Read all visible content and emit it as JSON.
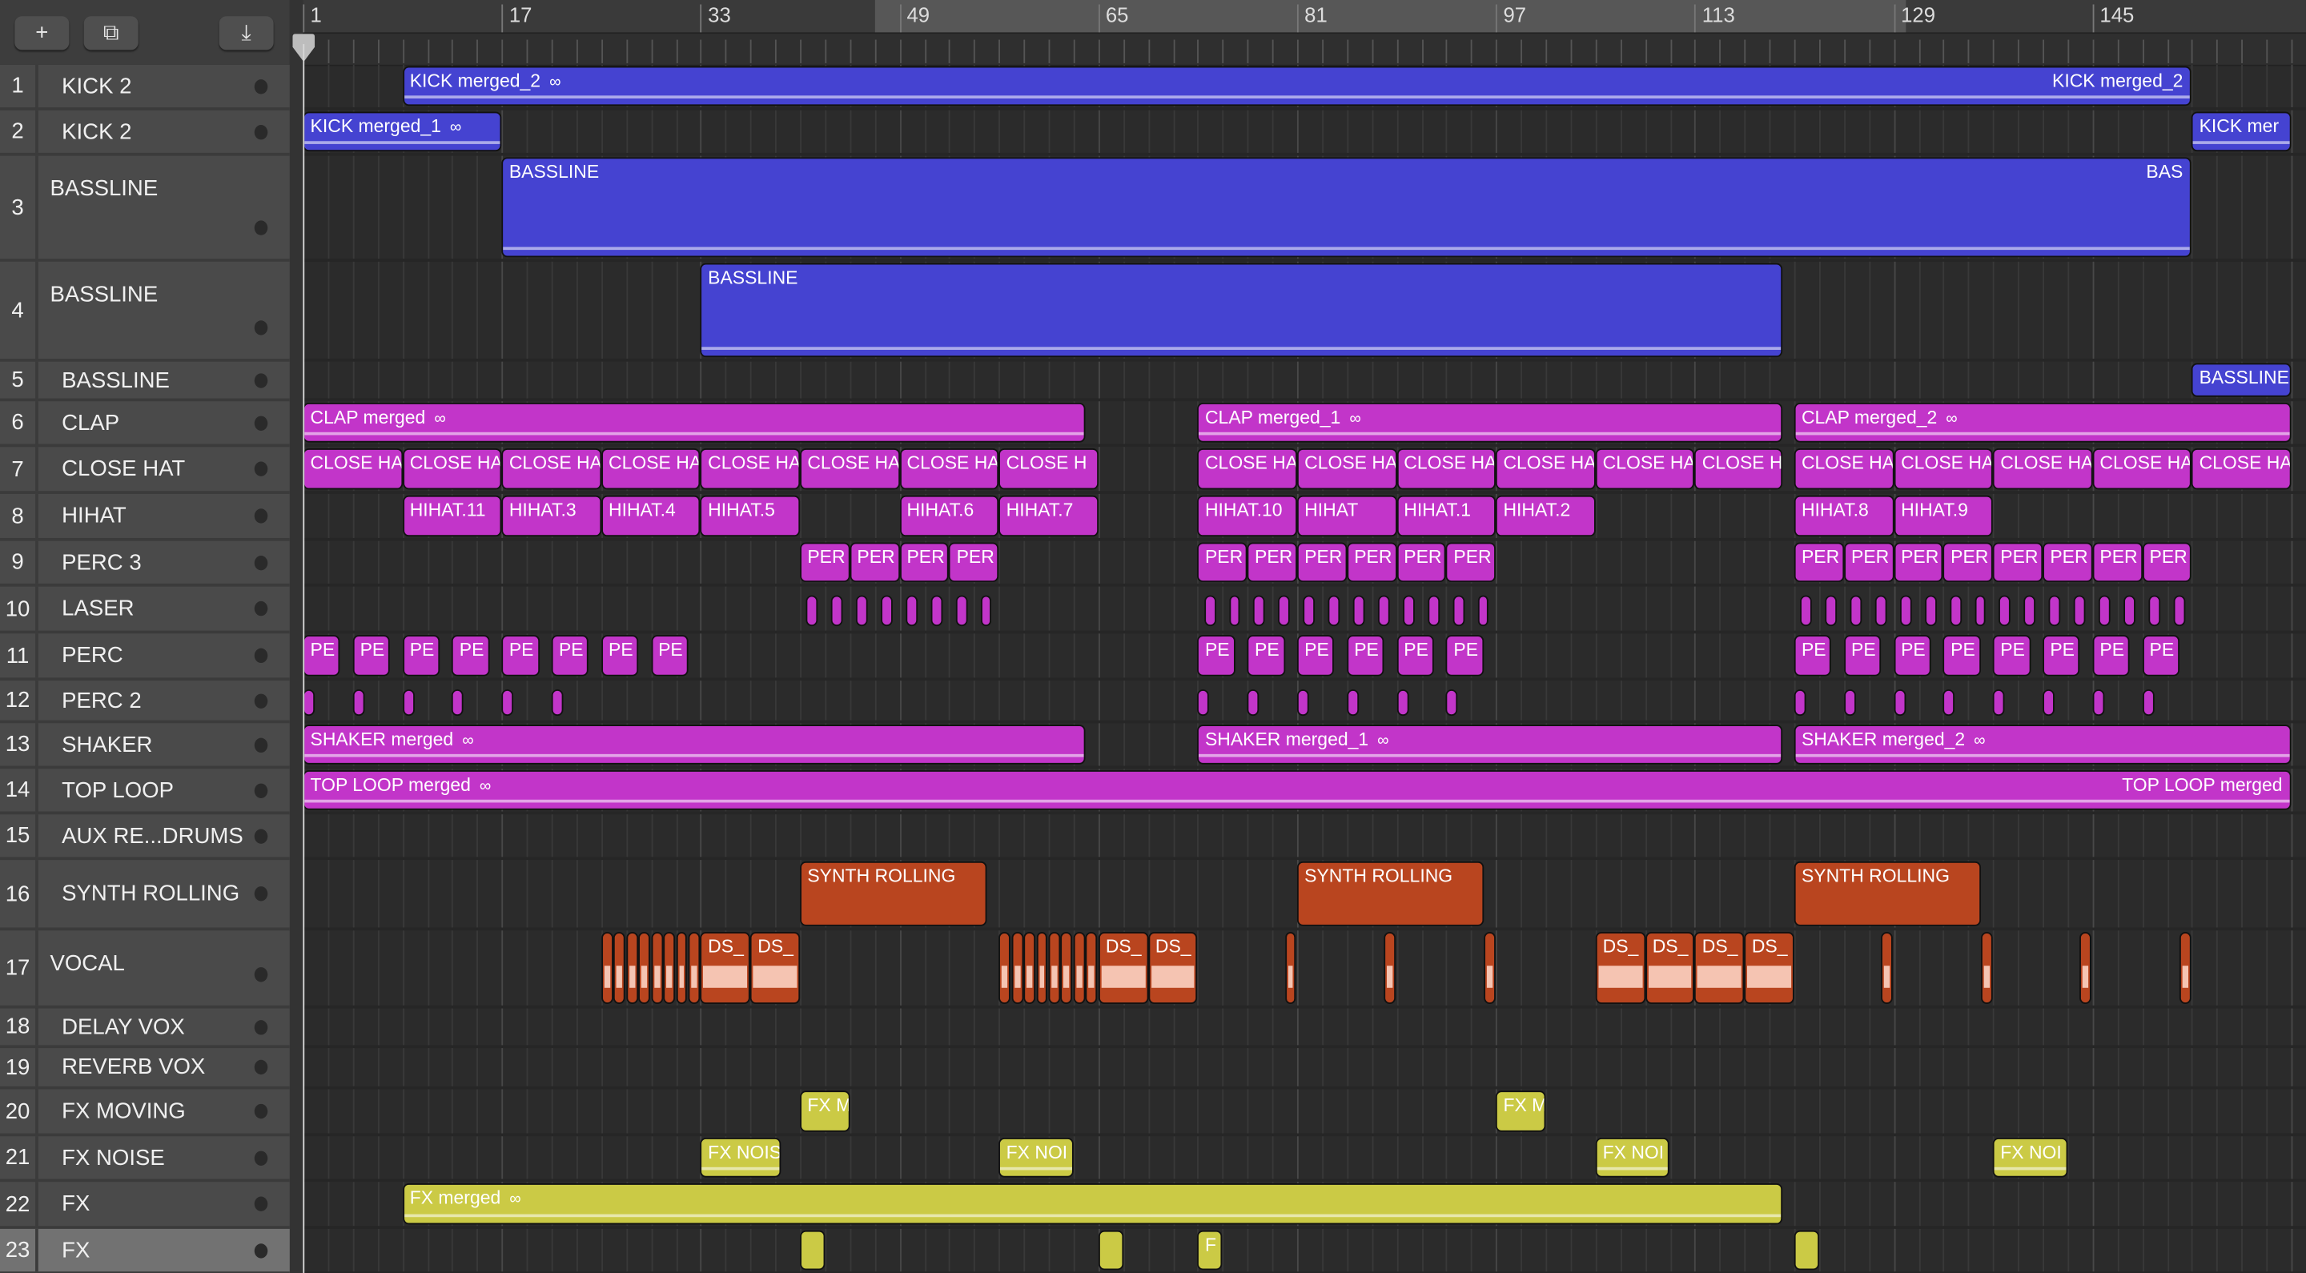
{
  "toolbar": {
    "add_label": "+",
    "duplicate_label": "⧉",
    "download_label": "⤓"
  },
  "ruler": {
    "markers": [
      1,
      17,
      33,
      49,
      65,
      81,
      97,
      113,
      129,
      145
    ],
    "cycle_start_bar": 47,
    "cycle_end_bar": 130
  },
  "colors": {
    "blue": "#4543d1",
    "magenta": "#c235c9",
    "orange": "#b9451f",
    "yellow": "#cbca45"
  },
  "loop_icon": "∞",
  "tracks": [
    {
      "num": "1",
      "name": "KICK 2",
      "color": "blue",
      "regions": [
        [
          "KICK merged_2",
          9,
          153,
          "KICK merged_2",
          "wave",
          true
        ]
      ]
    },
    {
      "num": "2",
      "name": "KICK 2",
      "color": "blue",
      "regions": [
        [
          "KICK merged_1",
          1,
          17,
          "",
          "wave",
          true
        ],
        [
          "KICK mer",
          153,
          161,
          "",
          "wave",
          false
        ]
      ]
    },
    {
      "num": "3",
      "name": "BASSLINE",
      "color": "blue",
      "tall": true,
      "regions": [
        [
          "BASSLINE",
          17,
          153,
          "BAS",
          "wave",
          false
        ]
      ]
    },
    {
      "num": "4",
      "name": "BASSLINE",
      "color": "blue",
      "tall": true,
      "regions": [
        [
          "BASSLINE",
          33,
          120,
          "",
          "wave",
          false
        ]
      ]
    },
    {
      "num": "5",
      "name": "BASSLINE",
      "color": "blue",
      "regions": [
        [
          "BASSLINE",
          153,
          161,
          "",
          "",
          false
        ]
      ]
    },
    {
      "num": "6",
      "name": "CLAP",
      "color": "magenta",
      "regions": [
        [
          "CLAP merged",
          1,
          64,
          "",
          "wave",
          true
        ],
        [
          "CLAP merged_1",
          73,
          120,
          "",
          "wave",
          true
        ],
        [
          "CLAP merged_2",
          121,
          161,
          "",
          "wave",
          true
        ]
      ]
    },
    {
      "num": "7",
      "name": "CLOSE HAT",
      "color": "magenta",
      "regions": [
        [
          "CLOSE HA",
          1,
          9
        ],
        [
          "CLOSE HA",
          9,
          17
        ],
        [
          "CLOSE HA",
          17,
          25
        ],
        [
          "CLOSE HA",
          25,
          33
        ],
        [
          "CLOSE HA",
          33,
          41
        ],
        [
          "CLOSE HA",
          41,
          49
        ],
        [
          "CLOSE HA",
          49,
          57
        ],
        [
          "CLOSE H",
          57,
          65
        ],
        [
          "CLOSE HA",
          73,
          81
        ],
        [
          "CLOSE HA",
          81,
          89
        ],
        [
          "CLOSE HA",
          89,
          97
        ],
        [
          "CLOSE HA",
          97,
          105
        ],
        [
          "CLOSE HA",
          105,
          113
        ],
        [
          "CLOSE H",
          113,
          120
        ],
        [
          "CLOSE HA",
          121,
          129
        ],
        [
          "CLOSE HA",
          129,
          137
        ],
        [
          "CLOSE HA",
          137,
          145
        ],
        [
          "CLOSE HA",
          145,
          153
        ],
        [
          "CLOSE HA",
          153,
          161
        ]
      ]
    },
    {
      "num": "8",
      "name": "HIHAT",
      "color": "magenta",
      "regions": [
        [
          "HIHAT.11",
          9,
          17
        ],
        [
          "HIHAT.3",
          17,
          25
        ],
        [
          "HIHAT.4",
          25,
          33
        ],
        [
          "HIHAT.5",
          33,
          41
        ],
        [
          "HIHAT.6",
          49,
          57
        ],
        [
          "HIHAT.7",
          57,
          65
        ],
        [
          "HIHAT.10",
          73,
          81
        ],
        [
          "HIHAT",
          81,
          89
        ],
        [
          "HIHAT.1",
          89,
          97
        ],
        [
          "HIHAT.2",
          97,
          105
        ],
        [
          "HIHAT.8",
          121,
          129
        ],
        [
          "HIHAT.9",
          129,
          137
        ]
      ]
    },
    {
      "num": "9",
      "name": "PERC 3",
      "color": "magenta",
      "regions": [
        [
          "PER",
          41,
          45
        ],
        [
          "PER",
          45,
          49
        ],
        [
          "PER",
          49,
          53
        ],
        [
          "PER",
          53,
          57
        ],
        [
          "PER",
          73,
          77
        ],
        [
          "PER",
          77,
          81
        ],
        [
          "PER",
          81,
          85
        ],
        [
          "PER",
          85,
          89
        ],
        [
          "PER",
          89,
          93
        ],
        [
          "PER",
          93,
          97
        ],
        [
          "PER",
          121,
          125
        ],
        [
          "PER",
          125,
          129
        ],
        [
          "PER",
          129,
          133
        ],
        [
          "PER",
          133,
          137
        ],
        [
          "PER",
          137,
          141
        ],
        [
          "PER",
          141,
          145
        ],
        [
          "PER",
          145,
          149
        ],
        [
          "PER",
          149,
          153
        ]
      ]
    },
    {
      "num": "10",
      "name": "LASER",
      "color": "magenta",
      "slivers": [
        41.5,
        43.5,
        45.5,
        47.5,
        49.5,
        51.5,
        53.5,
        55.5,
        73.5,
        75.5,
        77.5,
        79.5,
        81.5,
        83.5,
        85.5,
        87.5,
        89.5,
        91.5,
        93.5,
        95.5,
        121.5,
        123.5,
        125.5,
        127.5,
        129.5,
        131.5,
        133.5,
        135.5,
        137.5,
        139.5,
        141.5,
        143.5,
        145.5,
        147.5,
        149.5,
        151.5
      ],
      "regions": []
    },
    {
      "num": "11",
      "name": "PERC",
      "color": "magenta",
      "regions": [
        [
          "PE",
          1,
          4
        ],
        [
          "PE",
          5,
          8
        ],
        [
          "PE",
          9,
          12
        ],
        [
          "PE",
          13,
          16
        ],
        [
          "PE",
          17,
          20
        ],
        [
          "PE",
          21,
          24
        ],
        [
          "PE",
          25,
          28
        ],
        [
          "PE",
          29,
          32
        ],
        [
          "PE",
          73,
          76
        ],
        [
          "PE",
          77,
          80
        ],
        [
          "PE",
          81,
          84
        ],
        [
          "PE",
          85,
          88
        ],
        [
          "PE",
          89,
          92
        ],
        [
          "PE",
          93,
          96
        ],
        [
          "PE",
          121,
          124
        ],
        [
          "PE",
          125,
          128
        ],
        [
          "PE",
          129,
          132
        ],
        [
          "PE",
          133,
          136
        ],
        [
          "PE",
          137,
          140
        ],
        [
          "PE",
          141,
          144
        ],
        [
          "PE",
          145,
          148
        ],
        [
          "PE",
          149,
          152
        ]
      ]
    },
    {
      "num": "12",
      "name": "PERC 2",
      "color": "magenta",
      "slivers": [
        1,
        5,
        9,
        13,
        17,
        21,
        73,
        77,
        81,
        85,
        89,
        93,
        121,
        125,
        129,
        133,
        137,
        141,
        145,
        149
      ],
      "regions": []
    },
    {
      "num": "13",
      "name": "SHAKER",
      "color": "magenta",
      "regions": [
        [
          "SHAKER merged",
          1,
          64,
          "",
          "wave",
          true
        ],
        [
          "SHAKER merged_1",
          73,
          120,
          "",
          "wave",
          true
        ],
        [
          "SHAKER merged_2",
          121,
          161,
          "",
          "wave",
          true
        ]
      ]
    },
    {
      "num": "14",
      "name": "TOP LOOP",
      "color": "magenta",
      "regions": [
        [
          "TOP LOOP merged",
          1,
          161,
          "TOP LOOP merged",
          "wave",
          true
        ]
      ]
    },
    {
      "num": "15",
      "name": "AUX RE...DRUMS",
      "color": "magenta",
      "regions": []
    },
    {
      "num": "16",
      "name": "SYNTH ROLLING",
      "color": "orange",
      "regions": [
        [
          "SYNTH ROLLING",
          41,
          56
        ],
        [
          "SYNTH ROLLING",
          81,
          96
        ],
        [
          "SYNTH ROLLING",
          121,
          136
        ]
      ]
    },
    {
      "num": "17",
      "name": "VOCAL",
      "color": "orange",
      "tall": true,
      "slivers": [
        25,
        26,
        27,
        28,
        29,
        30,
        31,
        32,
        57,
        58,
        59,
        60,
        61,
        62,
        63,
        64,
        80,
        88,
        96,
        128,
        136,
        144,
        152
      ],
      "regions": [
        [
          "DS_",
          33,
          37,
          "",
          "audio"
        ],
        [
          "DS_",
          37,
          41,
          "",
          "audio"
        ],
        [
          "DS_",
          65,
          69,
          "",
          "audio"
        ],
        [
          "DS_",
          69,
          73,
          "",
          "audio"
        ],
        [
          "DS_",
          105,
          109,
          "",
          "audio"
        ],
        [
          "DS_",
          109,
          113,
          "",
          "audio"
        ],
        [
          "DS_",
          113,
          117,
          "",
          "audio"
        ],
        [
          "DS_",
          117,
          121,
          "",
          "audio"
        ]
      ]
    },
    {
      "num": "18",
      "name": "DELAY VOX",
      "color": "orange",
      "regions": []
    },
    {
      "num": "19",
      "name": "REVERB VOX",
      "color": "orange",
      "regions": []
    },
    {
      "num": "20",
      "name": "FX MOVING",
      "color": "yellow",
      "regions": [
        [
          "FX M",
          41,
          45
        ],
        [
          "FX M",
          97,
          101
        ]
      ]
    },
    {
      "num": "21",
      "name": "FX NOISE",
      "color": "yellow",
      "regions": [
        [
          "FX NOIS",
          33,
          39.5,
          "",
          "wave"
        ],
        [
          "FX NOI",
          57,
          63,
          "",
          "wave"
        ],
        [
          "FX NOI",
          105,
          111,
          "",
          "wave"
        ],
        [
          "FX NOI",
          137,
          143,
          "",
          "wave"
        ]
      ]
    },
    {
      "num": "22",
      "name": "FX",
      "color": "yellow",
      "regions": [
        [
          "FX merged",
          9,
          120,
          "",
          "wave",
          true
        ]
      ]
    },
    {
      "num": "23",
      "name": "FX",
      "color": "yellow",
      "selected": true,
      "regions": [
        [
          "",
          41,
          43
        ],
        [
          "",
          65,
          67
        ],
        [
          "F",
          73,
          75
        ],
        [
          "",
          121,
          123
        ]
      ]
    }
  ]
}
